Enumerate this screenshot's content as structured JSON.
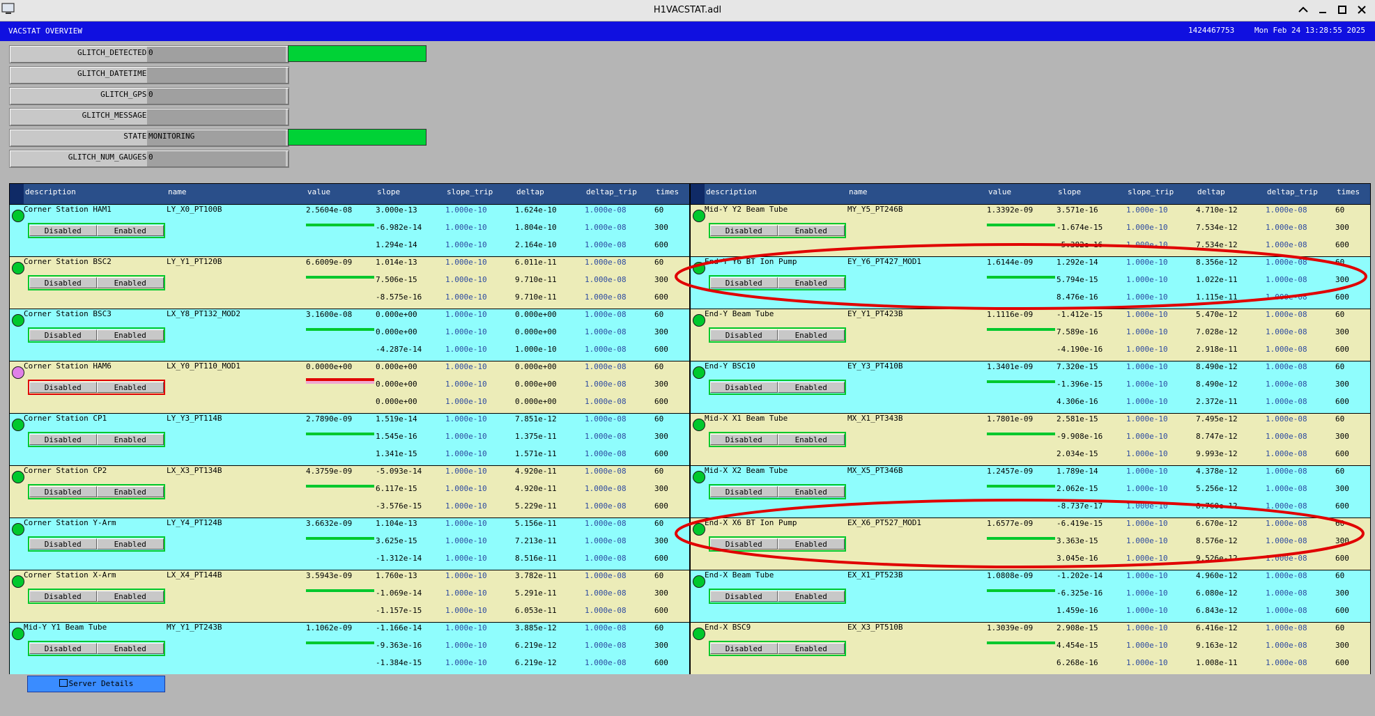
{
  "window": {
    "title": "H1VACSTAT.adl"
  },
  "header": {
    "title": "VACSTAT OVERVIEW",
    "gps": "1424467753",
    "datetime": "Mon Feb 24 13:28:55 2025"
  },
  "status": [
    {
      "label": "GLITCH_DETECTED:",
      "value": "0",
      "green": true
    },
    {
      "label": "GLITCH_DATETIME:",
      "value": "",
      "green": false
    },
    {
      "label": "GLITCH_GPS:",
      "value": "0",
      "green": false
    },
    {
      "label": "GLITCH_MESSAGE:",
      "value": "",
      "green": false
    },
    {
      "label": "STATE:",
      "value": "MONITORING",
      "green": true
    },
    {
      "label": "GLITCH_NUM_GAUGES:",
      "value": "0",
      "green": false
    }
  ],
  "columns": [
    "description",
    "name",
    "value",
    "slope",
    "slope_trip",
    "deltap",
    "deltap_trip",
    "times"
  ],
  "buttons": {
    "disabled": "Disabled",
    "enabled": "Enabled",
    "server": "Server Details"
  },
  "gauges_left": [
    {
      "description": "Corner Station HAM1",
      "name": "LY_X0_PT100B",
      "value": "2.5604e-08",
      "status": "ok",
      "slope": [
        "3.000e-13",
        "-6.982e-14",
        "1.294e-14"
      ],
      "slope_trip": [
        "1.000e-10",
        "1.000e-10",
        "1.000e-10"
      ],
      "deltap": [
        "1.624e-10",
        "1.804e-10",
        "2.164e-10"
      ],
      "deltap_trip": [
        "1.000e-08",
        "1.000e-08",
        "1.000e-08"
      ],
      "times": [
        "60",
        "300",
        "600"
      ]
    },
    {
      "description": "Corner Station BSC2",
      "name": "LY_Y1_PT120B",
      "value": "6.6009e-09",
      "status": "ok",
      "slope": [
        "1.014e-13",
        "7.506e-15",
        "-8.575e-16"
      ],
      "slope_trip": [
        "1.000e-10",
        "1.000e-10",
        "1.000e-10"
      ],
      "deltap": [
        "6.011e-11",
        "9.710e-11",
        "9.710e-11"
      ],
      "deltap_trip": [
        "1.000e-08",
        "1.000e-08",
        "1.000e-08"
      ],
      "times": [
        "60",
        "300",
        "600"
      ]
    },
    {
      "description": "Corner Station BSC3",
      "name": "LX_Y8_PT132_MOD2",
      "value": "3.1600e-08",
      "status": "ok",
      "slope": [
        "0.000e+00",
        "0.000e+00",
        "-4.287e-14"
      ],
      "slope_trip": [
        "1.000e-10",
        "1.000e-10",
        "1.000e-10"
      ],
      "deltap": [
        "0.000e+00",
        "0.000e+00",
        "1.000e-10"
      ],
      "deltap_trip": [
        "1.000e-08",
        "1.000e-08",
        "1.000e-08"
      ],
      "times": [
        "60",
        "300",
        "600"
      ]
    },
    {
      "description": "Corner Station HAM6",
      "name": "LX_Y0_PT110_MOD1",
      "value": "0.0000e+00",
      "status": "alarm",
      "slope": [
        "0.000e+00",
        "0.000e+00",
        "0.000e+00"
      ],
      "slope_trip": [
        "1.000e-10",
        "1.000e-10",
        "1.000e-10"
      ],
      "deltap": [
        "0.000e+00",
        "0.000e+00",
        "0.000e+00"
      ],
      "deltap_trip": [
        "1.000e-08",
        "1.000e-08",
        "1.000e-08"
      ],
      "times": [
        "60",
        "300",
        "600"
      ]
    },
    {
      "description": "Corner Station CP1",
      "name": "LY_Y3_PT114B",
      "value": "2.7890e-09",
      "status": "ok",
      "slope": [
        "1.519e-14",
        "1.545e-16",
        "1.341e-15"
      ],
      "slope_trip": [
        "1.000e-10",
        "1.000e-10",
        "1.000e-10"
      ],
      "deltap": [
        "7.851e-12",
        "1.375e-11",
        "1.571e-11"
      ],
      "deltap_trip": [
        "1.000e-08",
        "1.000e-08",
        "1.000e-08"
      ],
      "times": [
        "60",
        "300",
        "600"
      ]
    },
    {
      "description": "Corner Station CP2",
      "name": "LX_X3_PT134B",
      "value": "4.3759e-09",
      "status": "ok",
      "slope": [
        "-5.093e-14",
        "6.117e-15",
        "-3.576e-15"
      ],
      "slope_trip": [
        "1.000e-10",
        "1.000e-10",
        "1.000e-10"
      ],
      "deltap": [
        "4.920e-11",
        "4.920e-11",
        "5.229e-11"
      ],
      "deltap_trip": [
        "1.000e-08",
        "1.000e-08",
        "1.000e-08"
      ],
      "times": [
        "60",
        "300",
        "600"
      ]
    },
    {
      "description": "Corner Station Y-Arm",
      "name": "LY_Y4_PT124B",
      "value": "3.6632e-09",
      "status": "ok",
      "slope": [
        "1.104e-13",
        "3.625e-15",
        "-1.312e-14"
      ],
      "slope_trip": [
        "1.000e-10",
        "1.000e-10",
        "1.000e-10"
      ],
      "deltap": [
        "5.156e-11",
        "7.213e-11",
        "8.516e-11"
      ],
      "deltap_trip": [
        "1.000e-08",
        "1.000e-08",
        "1.000e-08"
      ],
      "times": [
        "60",
        "300",
        "600"
      ]
    },
    {
      "description": "Corner Station X-Arm",
      "name": "LX_X4_PT144B",
      "value": "3.5943e-09",
      "status": "ok",
      "slope": [
        "1.760e-13",
        "-1.069e-14",
        "-1.157e-15"
      ],
      "slope_trip": [
        "1.000e-10",
        "1.000e-10",
        "1.000e-10"
      ],
      "deltap": [
        "3.782e-11",
        "5.291e-11",
        "6.053e-11"
      ],
      "deltap_trip": [
        "1.000e-08",
        "1.000e-08",
        "1.000e-08"
      ],
      "times": [
        "60",
        "300",
        "600"
      ]
    },
    {
      "description": "Mid-Y Y1 Beam Tube",
      "name": "MY_Y1_PT243B",
      "value": "1.1062e-09",
      "status": "ok",
      "slope": [
        "-1.166e-14",
        "-9.363e-16",
        "-1.384e-15"
      ],
      "slope_trip": [
        "1.000e-10",
        "1.000e-10",
        "1.000e-10"
      ],
      "deltap": [
        "3.885e-12",
        "6.219e-12",
        "6.219e-12"
      ],
      "deltap_trip": [
        "1.000e-08",
        "1.000e-08",
        "1.000e-08"
      ],
      "times": [
        "60",
        "300",
        "600"
      ]
    }
  ],
  "gauges_right": [
    {
      "description": "Mid-Y Y2 Beam Tube",
      "name": "MY_Y5_PT246B",
      "value": "1.3392e-09",
      "status": "ok",
      "slope": [
        "3.571e-16",
        "-1.674e-15",
        "-5.382e-16"
      ],
      "slope_trip": [
        "1.000e-10",
        "1.000e-10",
        "1.000e-10"
      ],
      "deltap": [
        "4.710e-12",
        "7.534e-12",
        "7.534e-12"
      ],
      "deltap_trip": [
        "1.000e-08",
        "1.000e-08",
        "1.000e-08"
      ],
      "times": [
        "60",
        "300",
        "600"
      ]
    },
    {
      "description": "End-Y Y6 BT Ion Pump",
      "name": "EY_Y6_PT427_MOD1",
      "value": "1.6144e-09",
      "status": "ok",
      "slope": [
        "1.292e-14",
        "5.794e-15",
        "8.476e-16"
      ],
      "slope_trip": [
        "1.000e-10",
        "1.000e-10",
        "1.000e-10"
      ],
      "deltap": [
        "8.356e-12",
        "1.022e-11",
        "1.115e-11"
      ],
      "deltap_trip": [
        "1.000e-08",
        "1.000e-08",
        "1.000e-08"
      ],
      "times": [
        "60",
        "300",
        "600"
      ]
    },
    {
      "description": "End-Y Beam Tube",
      "name": "EY_Y1_PT423B",
      "value": "1.1116e-09",
      "status": "ok",
      "slope": [
        "-1.412e-15",
        "7.589e-16",
        "-4.190e-16"
      ],
      "slope_trip": [
        "1.000e-10",
        "1.000e-10",
        "1.000e-10"
      ],
      "deltap": [
        "5.470e-12",
        "7.028e-12",
        "2.918e-11"
      ],
      "deltap_trip": [
        "1.000e-08",
        "1.000e-08",
        "1.000e-08"
      ],
      "times": [
        "60",
        "300",
        "600"
      ]
    },
    {
      "description": "End-Y BSC10",
      "name": "EY_Y3_PT410B",
      "value": "1.3401e-09",
      "status": "ok",
      "slope": [
        "7.320e-15",
        "-1.396e-15",
        "4.306e-16"
      ],
      "slope_trip": [
        "1.000e-10",
        "1.000e-10",
        "1.000e-10"
      ],
      "deltap": [
        "8.490e-12",
        "8.490e-12",
        "2.372e-11"
      ],
      "deltap_trip": [
        "1.000e-08",
        "1.000e-08",
        "1.000e-08"
      ],
      "times": [
        "60",
        "300",
        "600"
      ]
    },
    {
      "description": "Mid-X X1 Beam Tube",
      "name": "MX_X1_PT343B",
      "value": "1.7801e-09",
      "status": "ok",
      "slope": [
        "2.581e-15",
        "-9.908e-16",
        "2.034e-15"
      ],
      "slope_trip": [
        "1.000e-10",
        "1.000e-10",
        "1.000e-10"
      ],
      "deltap": [
        "7.495e-12",
        "8.747e-12",
        "9.993e-12"
      ],
      "deltap_trip": [
        "1.000e-08",
        "1.000e-08",
        "1.000e-08"
      ],
      "times": [
        "60",
        "300",
        "600"
      ]
    },
    {
      "description": "Mid-X X2 Beam Tube",
      "name": "MX_X5_PT346B",
      "value": "1.2457e-09",
      "status": "ok",
      "slope": [
        "1.789e-14",
        "2.062e-15",
        "-8.737e-17"
      ],
      "slope_trip": [
        "1.000e-10",
        "1.000e-10",
        "1.000e-10"
      ],
      "deltap": [
        "4.378e-12",
        "5.256e-12",
        "8.760e-12"
      ],
      "deltap_trip": [
        "1.000e-08",
        "1.000e-08",
        "1.000e-08"
      ],
      "times": [
        "60",
        "300",
        "600"
      ]
    },
    {
      "description": "End-X X6 BT Ion Pump",
      "name": "EX_X6_PT527_MOD1",
      "value": "1.6577e-09",
      "status": "ok",
      "slope": [
        "-6.419e-15",
        "3.363e-15",
        "3.045e-16"
      ],
      "slope_trip": [
        "1.000e-10",
        "1.000e-10",
        "1.000e-10"
      ],
      "deltap": [
        "6.670e-12",
        "8.576e-12",
        "9.526e-12"
      ],
      "deltap_trip": [
        "1.000e-08",
        "1.000e-08",
        "1.000e-08"
      ],
      "times": [
        "60",
        "300",
        "600"
      ]
    },
    {
      "description": "End-X Beam Tube",
      "name": "EX_X1_PT523B",
      "value": "1.0808e-09",
      "status": "ok",
      "slope": [
        "-1.202e-14",
        "-6.325e-16",
        "1.459e-16"
      ],
      "slope_trip": [
        "1.000e-10",
        "1.000e-10",
        "1.000e-10"
      ],
      "deltap": [
        "4.960e-12",
        "6.080e-12",
        "6.843e-12"
      ],
      "deltap_trip": [
        "1.000e-08",
        "1.000e-08",
        "1.000e-08"
      ],
      "times": [
        "60",
        "300",
        "600"
      ]
    },
    {
      "description": "End-X BSC9",
      "name": "EX_X3_PT510B",
      "value": "1.3039e-09",
      "status": "ok",
      "slope": [
        "2.908e-15",
        "4.454e-15",
        "6.268e-16"
      ],
      "slope_trip": [
        "1.000e-10",
        "1.000e-10",
        "1.000e-10"
      ],
      "deltap": [
        "6.416e-12",
        "9.163e-12",
        "1.008e-11"
      ],
      "deltap_trip": [
        "1.000e-08",
        "1.000e-08",
        "1.000e-08"
      ],
      "times": [
        "60",
        "300",
        "600"
      ]
    }
  ],
  "annotation_color": "#e00000"
}
